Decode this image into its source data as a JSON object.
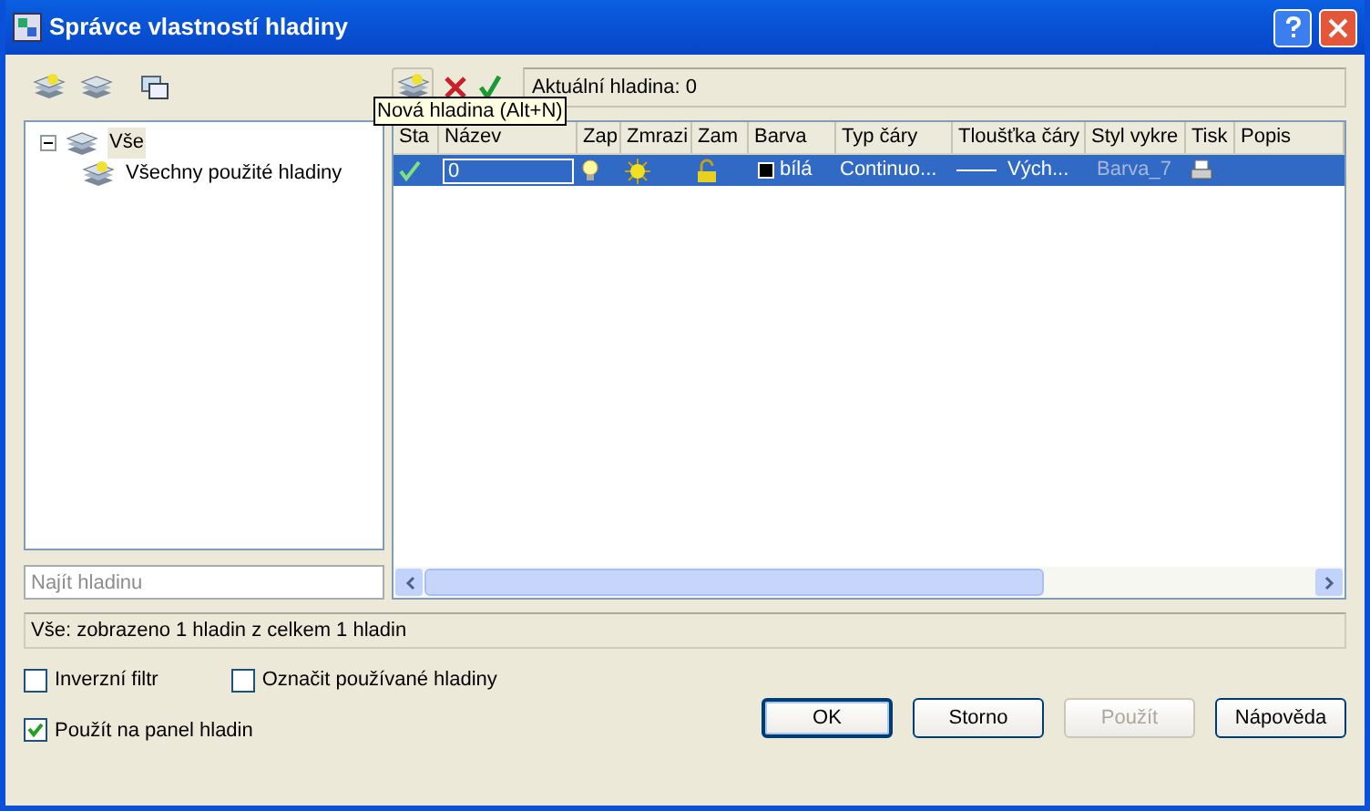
{
  "window": {
    "title": "Správce vlastností hladiny"
  },
  "tree": [
    {
      "label": "Vše",
      "selected": true,
      "expanded": true,
      "children": [
        {
          "label": "Všechny použité hladiny",
          "selected": false
        }
      ]
    }
  ],
  "search": {
    "placeholder": "Najít hladinu"
  },
  "current_layer": "Aktuální hladina: 0",
  "tooltip": "Nová hladina (Alt+N)",
  "table": {
    "columns": [
      "Sta",
      "Název",
      "Zap",
      "Zmrazi",
      "Zam",
      "Barva",
      "Typ čáry",
      "Tloušťka čáry",
      "Styl vykre",
      "Tisk",
      "Popis"
    ],
    "rows": [
      {
        "selected": true,
        "current": true,
        "name": "0",
        "on": true,
        "frozen": false,
        "locked": false,
        "color": "#000000",
        "color_name": "bílá",
        "linetype": "Continuo...",
        "lineweight": "Vých...",
        "plot_style": "Barva_7",
        "plot": true
      }
    ]
  },
  "status_bar": "Vše: zobrazeno 1 hladin z celkem 1 hladin",
  "options": [
    {
      "label": "Inverzní filtr",
      "checked": false
    },
    {
      "label": "Označit používané hladiny",
      "checked": false
    },
    {
      "label": "Použít na panel hladin",
      "checked": true
    }
  ],
  "buttons": [
    {
      "label": "OK",
      "default": true,
      "disabled": false
    },
    {
      "label": "Storno",
      "default": false,
      "disabled": false
    },
    {
      "label": "Použít",
      "default": false,
      "disabled": true
    },
    {
      "label": "Nápověda",
      "default": false,
      "disabled": false
    }
  ]
}
